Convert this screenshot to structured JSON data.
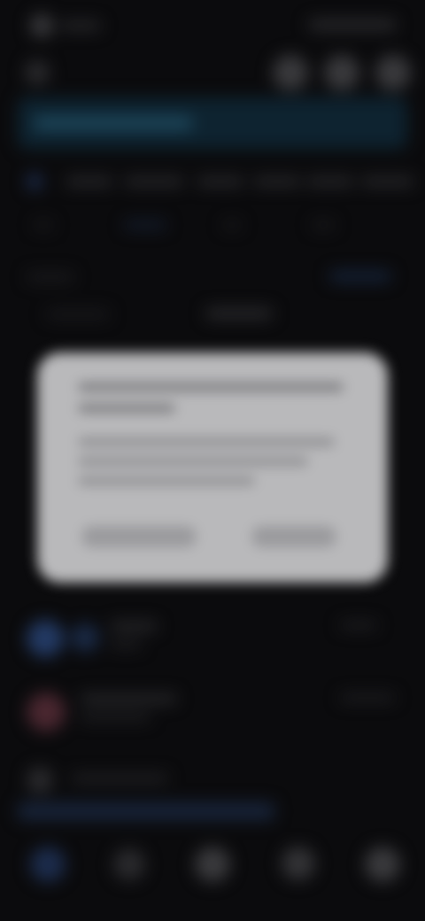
{
  "screen": {
    "status_bar": {
      "time": "",
      "battery": ""
    },
    "header": {
      "title": ""
    },
    "tabs": [],
    "modal": {
      "title": "",
      "message": "",
      "buttons": []
    },
    "list_items": [],
    "bottom_nav": []
  },
  "colors": {
    "background": "#0b0b0d",
    "header_band": "#0e2330",
    "modal_background": "#b9b9bb",
    "accent_blue": "#233a64",
    "accent_red": "#4a2730"
  },
  "icons": {
    "status_left": "app-icon",
    "header_actions": [
      "circle-icon",
      "circle-icon",
      "circle-icon"
    ],
    "bottom_nav": [
      "home-icon",
      "search-icon",
      "plus-icon",
      "chat-icon",
      "profile-icon"
    ]
  }
}
